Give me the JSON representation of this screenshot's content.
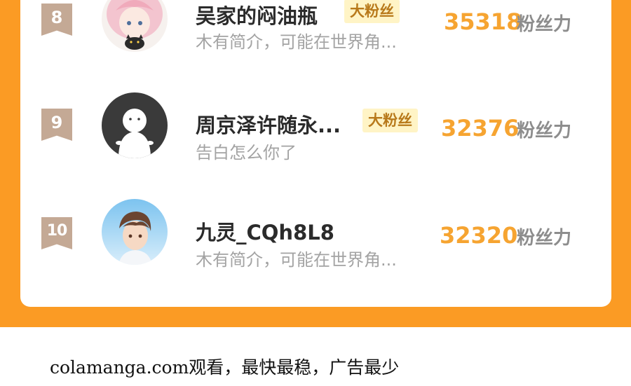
{
  "ranking": {
    "entries": [
      {
        "rank": "8",
        "avatar_icon": "anime-girl-with-black-cat-avatar-icon",
        "name": "吴家的闷油瓶",
        "badge": "大粉丝",
        "intro": "木有简介，可能在世界角...",
        "score": "35318",
        "score_unit": "粉丝力"
      },
      {
        "rank": "9",
        "avatar_icon": "default-ghost-avatar-icon",
        "name": "周京泽许随永...",
        "badge": "大粉丝",
        "intro": "告白怎么你了",
        "score": "32376",
        "score_unit": "粉丝力"
      },
      {
        "rank": "10",
        "avatar_icon": "anime-boy-sky-avatar-icon",
        "name": "九灵_CQh8L8",
        "badge": "",
        "intro": "木有简介，可能在世界角...",
        "score": "32320",
        "score_unit": "粉丝力"
      }
    ]
  },
  "colors": {
    "background_band": "#fb9b24",
    "rank_flag": "#c4a995",
    "score": "#f6a431",
    "badge_bg": "#fff4c6",
    "badge_text": "#b8791a"
  },
  "footer": {
    "text": "colamanga.com观看，最快最稳，广告最少"
  }
}
